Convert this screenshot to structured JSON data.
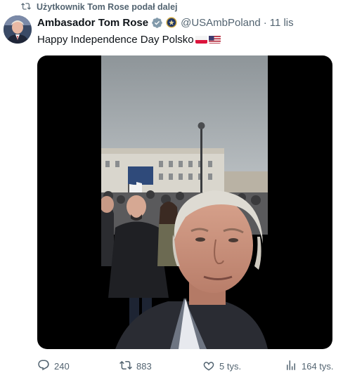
{
  "repost": {
    "icon": "repost-icon",
    "text": "Użytkownik Tom Rose podał dalej"
  },
  "author": {
    "avatar": "avatar-ambassador",
    "name": "Ambasador Tom Rose",
    "verified_icon": "verified-badge-icon",
    "affiliation_icon": "us-embassy-seal-icon",
    "handle": "@USAmbPoland",
    "separator": "·",
    "time": "11 lis"
  },
  "tweet": {
    "text": "Happy Independence Day Polsko",
    "emoji": [
      "poland-flag-icon",
      "us-flag-icon"
    ]
  },
  "media": {
    "type": "video",
    "description_icon": "video-player"
  },
  "actions": {
    "replies": {
      "icon": "reply-icon",
      "count": "240"
    },
    "reposts": {
      "icon": "repost-icon",
      "count": "883"
    },
    "likes": {
      "icon": "like-icon",
      "count": "5 tys."
    },
    "views": {
      "icon": "views-icon",
      "count": "164 tys."
    }
  },
  "colors": {
    "text": "#0f1419",
    "muted": "#536471",
    "verified": "#1d9bf0"
  }
}
